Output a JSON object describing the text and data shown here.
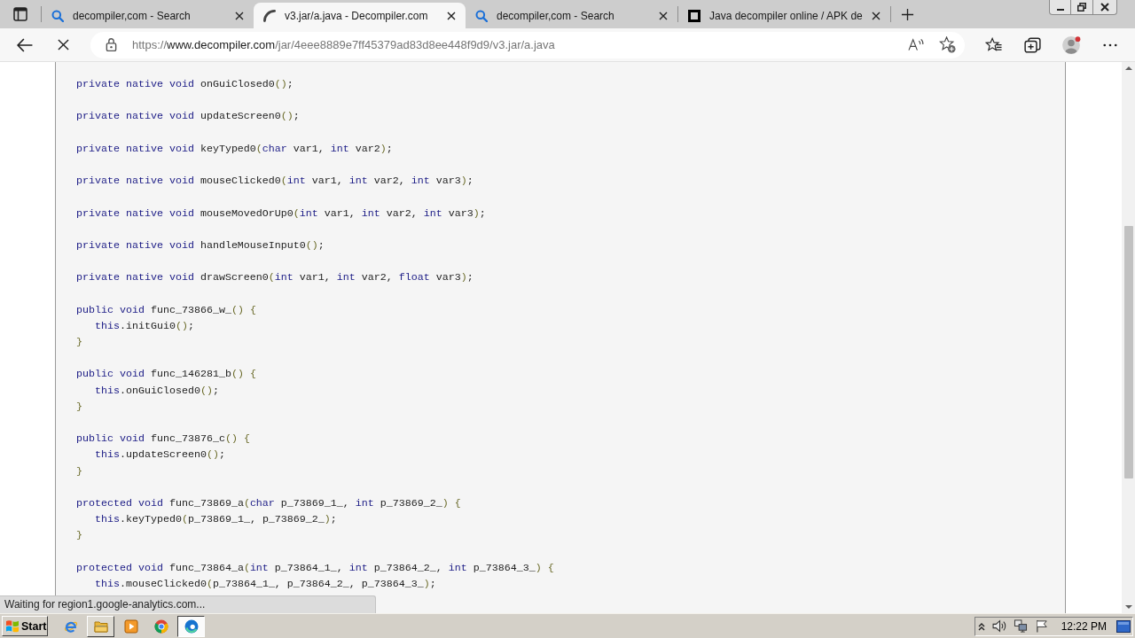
{
  "tabs": [
    {
      "kind": "search",
      "title": "decompiler,com - Search",
      "selected": false
    },
    {
      "kind": "loading",
      "title": "v3.jar/a.java - Decompiler.com",
      "selected": true
    },
    {
      "kind": "search",
      "title": "decompiler,com - Search",
      "selected": false
    },
    {
      "kind": "page",
      "title": "Java decompiler online / APK de",
      "selected": false
    }
  ],
  "navigation": {
    "loading": true
  },
  "address_bar": {
    "scheme": "https://",
    "host": "www.decompiler.com",
    "path": "/jar/4eee8889e7ff45379ad83d8ee448f9d9/v3.jar/a.java"
  },
  "code": [
    {
      "tokens": [
        {
          "kind": "keyword",
          "text": "private native void"
        },
        {
          "kind": "plain",
          "text": " onGuiClosed0"
        },
        {
          "kind": "bracket",
          "text": "()"
        },
        {
          "kind": "plain",
          "text": ";"
        }
      ]
    },
    {
      "tokens": [
        {
          "kind": "keyword",
          "text": "private native void"
        },
        {
          "kind": "plain",
          "text": " updateScreen0"
        },
        {
          "kind": "bracket",
          "text": "()"
        },
        {
          "kind": "plain",
          "text": ";"
        }
      ]
    },
    {
      "tokens": [
        {
          "kind": "keyword",
          "text": "private native void"
        },
        {
          "kind": "plain",
          "text": " keyTyped0"
        },
        {
          "kind": "bracket",
          "text": "("
        },
        {
          "kind": "keyword",
          "text": "char"
        },
        {
          "kind": "plain",
          "text": " var1, "
        },
        {
          "kind": "keyword",
          "text": "int"
        },
        {
          "kind": "plain",
          "text": " var2"
        },
        {
          "kind": "bracket",
          "text": ")"
        },
        {
          "kind": "plain",
          "text": ";"
        }
      ]
    },
    {
      "tokens": [
        {
          "kind": "keyword",
          "text": "private native void"
        },
        {
          "kind": "plain",
          "text": " mouseClicked0"
        },
        {
          "kind": "bracket",
          "text": "("
        },
        {
          "kind": "keyword",
          "text": "int"
        },
        {
          "kind": "plain",
          "text": " var1, "
        },
        {
          "kind": "keyword",
          "text": "int"
        },
        {
          "kind": "plain",
          "text": " var2, "
        },
        {
          "kind": "keyword",
          "text": "int"
        },
        {
          "kind": "plain",
          "text": " var3"
        },
        {
          "kind": "bracket",
          "text": ")"
        },
        {
          "kind": "plain",
          "text": ";"
        }
      ]
    },
    {
      "tokens": [
        {
          "kind": "keyword",
          "text": "private native void"
        },
        {
          "kind": "plain",
          "text": " mouseMovedOrUp0"
        },
        {
          "kind": "bracket",
          "text": "("
        },
        {
          "kind": "keyword",
          "text": "int"
        },
        {
          "kind": "plain",
          "text": " var1, "
        },
        {
          "kind": "keyword",
          "text": "int"
        },
        {
          "kind": "plain",
          "text": " var2, "
        },
        {
          "kind": "keyword",
          "text": "int"
        },
        {
          "kind": "plain",
          "text": " var3"
        },
        {
          "kind": "bracket",
          "text": ")"
        },
        {
          "kind": "plain",
          "text": ";"
        }
      ]
    },
    {
      "tokens": [
        {
          "kind": "keyword",
          "text": "private native void"
        },
        {
          "kind": "plain",
          "text": " handleMouseInput0"
        },
        {
          "kind": "bracket",
          "text": "()"
        },
        {
          "kind": "plain",
          "text": ";"
        }
      ]
    },
    {
      "tokens": [
        {
          "kind": "keyword",
          "text": "private native void"
        },
        {
          "kind": "plain",
          "text": " drawScreen0"
        },
        {
          "kind": "bracket",
          "text": "("
        },
        {
          "kind": "keyword",
          "text": "int"
        },
        {
          "kind": "plain",
          "text": " var1, "
        },
        {
          "kind": "keyword",
          "text": "int"
        },
        {
          "kind": "plain",
          "text": " var2, "
        },
        {
          "kind": "keyword",
          "text": "float"
        },
        {
          "kind": "plain",
          "text": " var3"
        },
        {
          "kind": "bracket",
          "text": ")"
        },
        {
          "kind": "plain",
          "text": ";"
        }
      ]
    },
    {
      "tokens": [
        {
          "kind": "keyword",
          "text": "public void"
        },
        {
          "kind": "plain",
          "text": " func_73866_w_"
        },
        {
          "kind": "bracket",
          "text": "() {"
        }
      ],
      "children": [
        {
          "tokens": [
            {
              "kind": "keyword",
              "text": "this"
            },
            {
              "kind": "plain",
              "text": ".initGui0"
            },
            {
              "kind": "bracket",
              "text": "()"
            },
            {
              "kind": "plain",
              "text": ";"
            }
          ]
        }
      ],
      "end": [
        {
          "kind": "bracket",
          "text": "}"
        }
      ]
    },
    {
      "tokens": [
        {
          "kind": "keyword",
          "text": "public void"
        },
        {
          "kind": "plain",
          "text": " func_146281_b"
        },
        {
          "kind": "bracket",
          "text": "() {"
        }
      ],
      "children": [
        {
          "tokens": [
            {
              "kind": "keyword",
              "text": "this"
            },
            {
              "kind": "plain",
              "text": ".onGuiClosed0"
            },
            {
              "kind": "bracket",
              "text": "()"
            },
            {
              "kind": "plain",
              "text": ";"
            }
          ]
        }
      ],
      "end": [
        {
          "kind": "bracket",
          "text": "}"
        }
      ]
    },
    {
      "tokens": [
        {
          "kind": "keyword",
          "text": "public void"
        },
        {
          "kind": "plain",
          "text": " func_73876_c"
        },
        {
          "kind": "bracket",
          "text": "() {"
        }
      ],
      "children": [
        {
          "tokens": [
            {
              "kind": "keyword",
              "text": "this"
            },
            {
              "kind": "plain",
              "text": ".updateScreen0"
            },
            {
              "kind": "bracket",
              "text": "()"
            },
            {
              "kind": "plain",
              "text": ";"
            }
          ]
        }
      ],
      "end": [
        {
          "kind": "bracket",
          "text": "}"
        }
      ]
    },
    {
      "tokens": [
        {
          "kind": "keyword",
          "text": "protected void"
        },
        {
          "kind": "plain",
          "text": " func_73869_a"
        },
        {
          "kind": "bracket",
          "text": "("
        },
        {
          "kind": "keyword",
          "text": "char"
        },
        {
          "kind": "plain",
          "text": " p_73869_1_, "
        },
        {
          "kind": "keyword",
          "text": "int"
        },
        {
          "kind": "plain",
          "text": " p_73869_2_"
        },
        {
          "kind": "bracket",
          "text": ") {"
        }
      ],
      "children": [
        {
          "tokens": [
            {
              "kind": "keyword",
              "text": "this"
            },
            {
              "kind": "plain",
              "text": ".keyTyped0"
            },
            {
              "kind": "bracket",
              "text": "("
            },
            {
              "kind": "plain",
              "text": "p_73869_1_, p_73869_2_"
            },
            {
              "kind": "bracket",
              "text": ")"
            },
            {
              "kind": "plain",
              "text": ";"
            }
          ]
        }
      ],
      "end": [
        {
          "kind": "bracket",
          "text": "}"
        }
      ]
    },
    {
      "tokens": [
        {
          "kind": "keyword",
          "text": "protected void"
        },
        {
          "kind": "plain",
          "text": " func_73864_a"
        },
        {
          "kind": "bracket",
          "text": "("
        },
        {
          "kind": "keyword",
          "text": "int"
        },
        {
          "kind": "plain",
          "text": " p_73864_1_, "
        },
        {
          "kind": "keyword",
          "text": "int"
        },
        {
          "kind": "plain",
          "text": " p_73864_2_, "
        },
        {
          "kind": "keyword",
          "text": "int"
        },
        {
          "kind": "plain",
          "text": " p_73864_3_"
        },
        {
          "kind": "bracket",
          "text": ") {"
        }
      ],
      "children": [
        {
          "tokens": [
            {
              "kind": "keyword",
              "text": "this"
            },
            {
              "kind": "plain",
              "text": ".mouseClicked0"
            },
            {
              "kind": "bracket",
              "text": "("
            },
            {
              "kind": "plain",
              "text": "p_73864_1_, p_73864_2_, p_73864_3_"
            },
            {
              "kind": "bracket",
              "text": ")"
            },
            {
              "kind": "plain",
              "text": ";"
            }
          ]
        }
      ]
    }
  ],
  "status_bubble": "Waiting for region1.google-analytics.com...",
  "taskbar": {
    "start": "Start",
    "apps": [
      {
        "kind": "ie",
        "open": false,
        "selected": false
      },
      {
        "kind": "explorer",
        "open": true,
        "selected": false
      },
      {
        "kind": "media",
        "open": false,
        "selected": false
      },
      {
        "kind": "chrome",
        "open": false,
        "selected": false
      },
      {
        "kind": "edge",
        "open": true,
        "selected": true
      }
    ],
    "clock": "12:22 PM"
  }
}
